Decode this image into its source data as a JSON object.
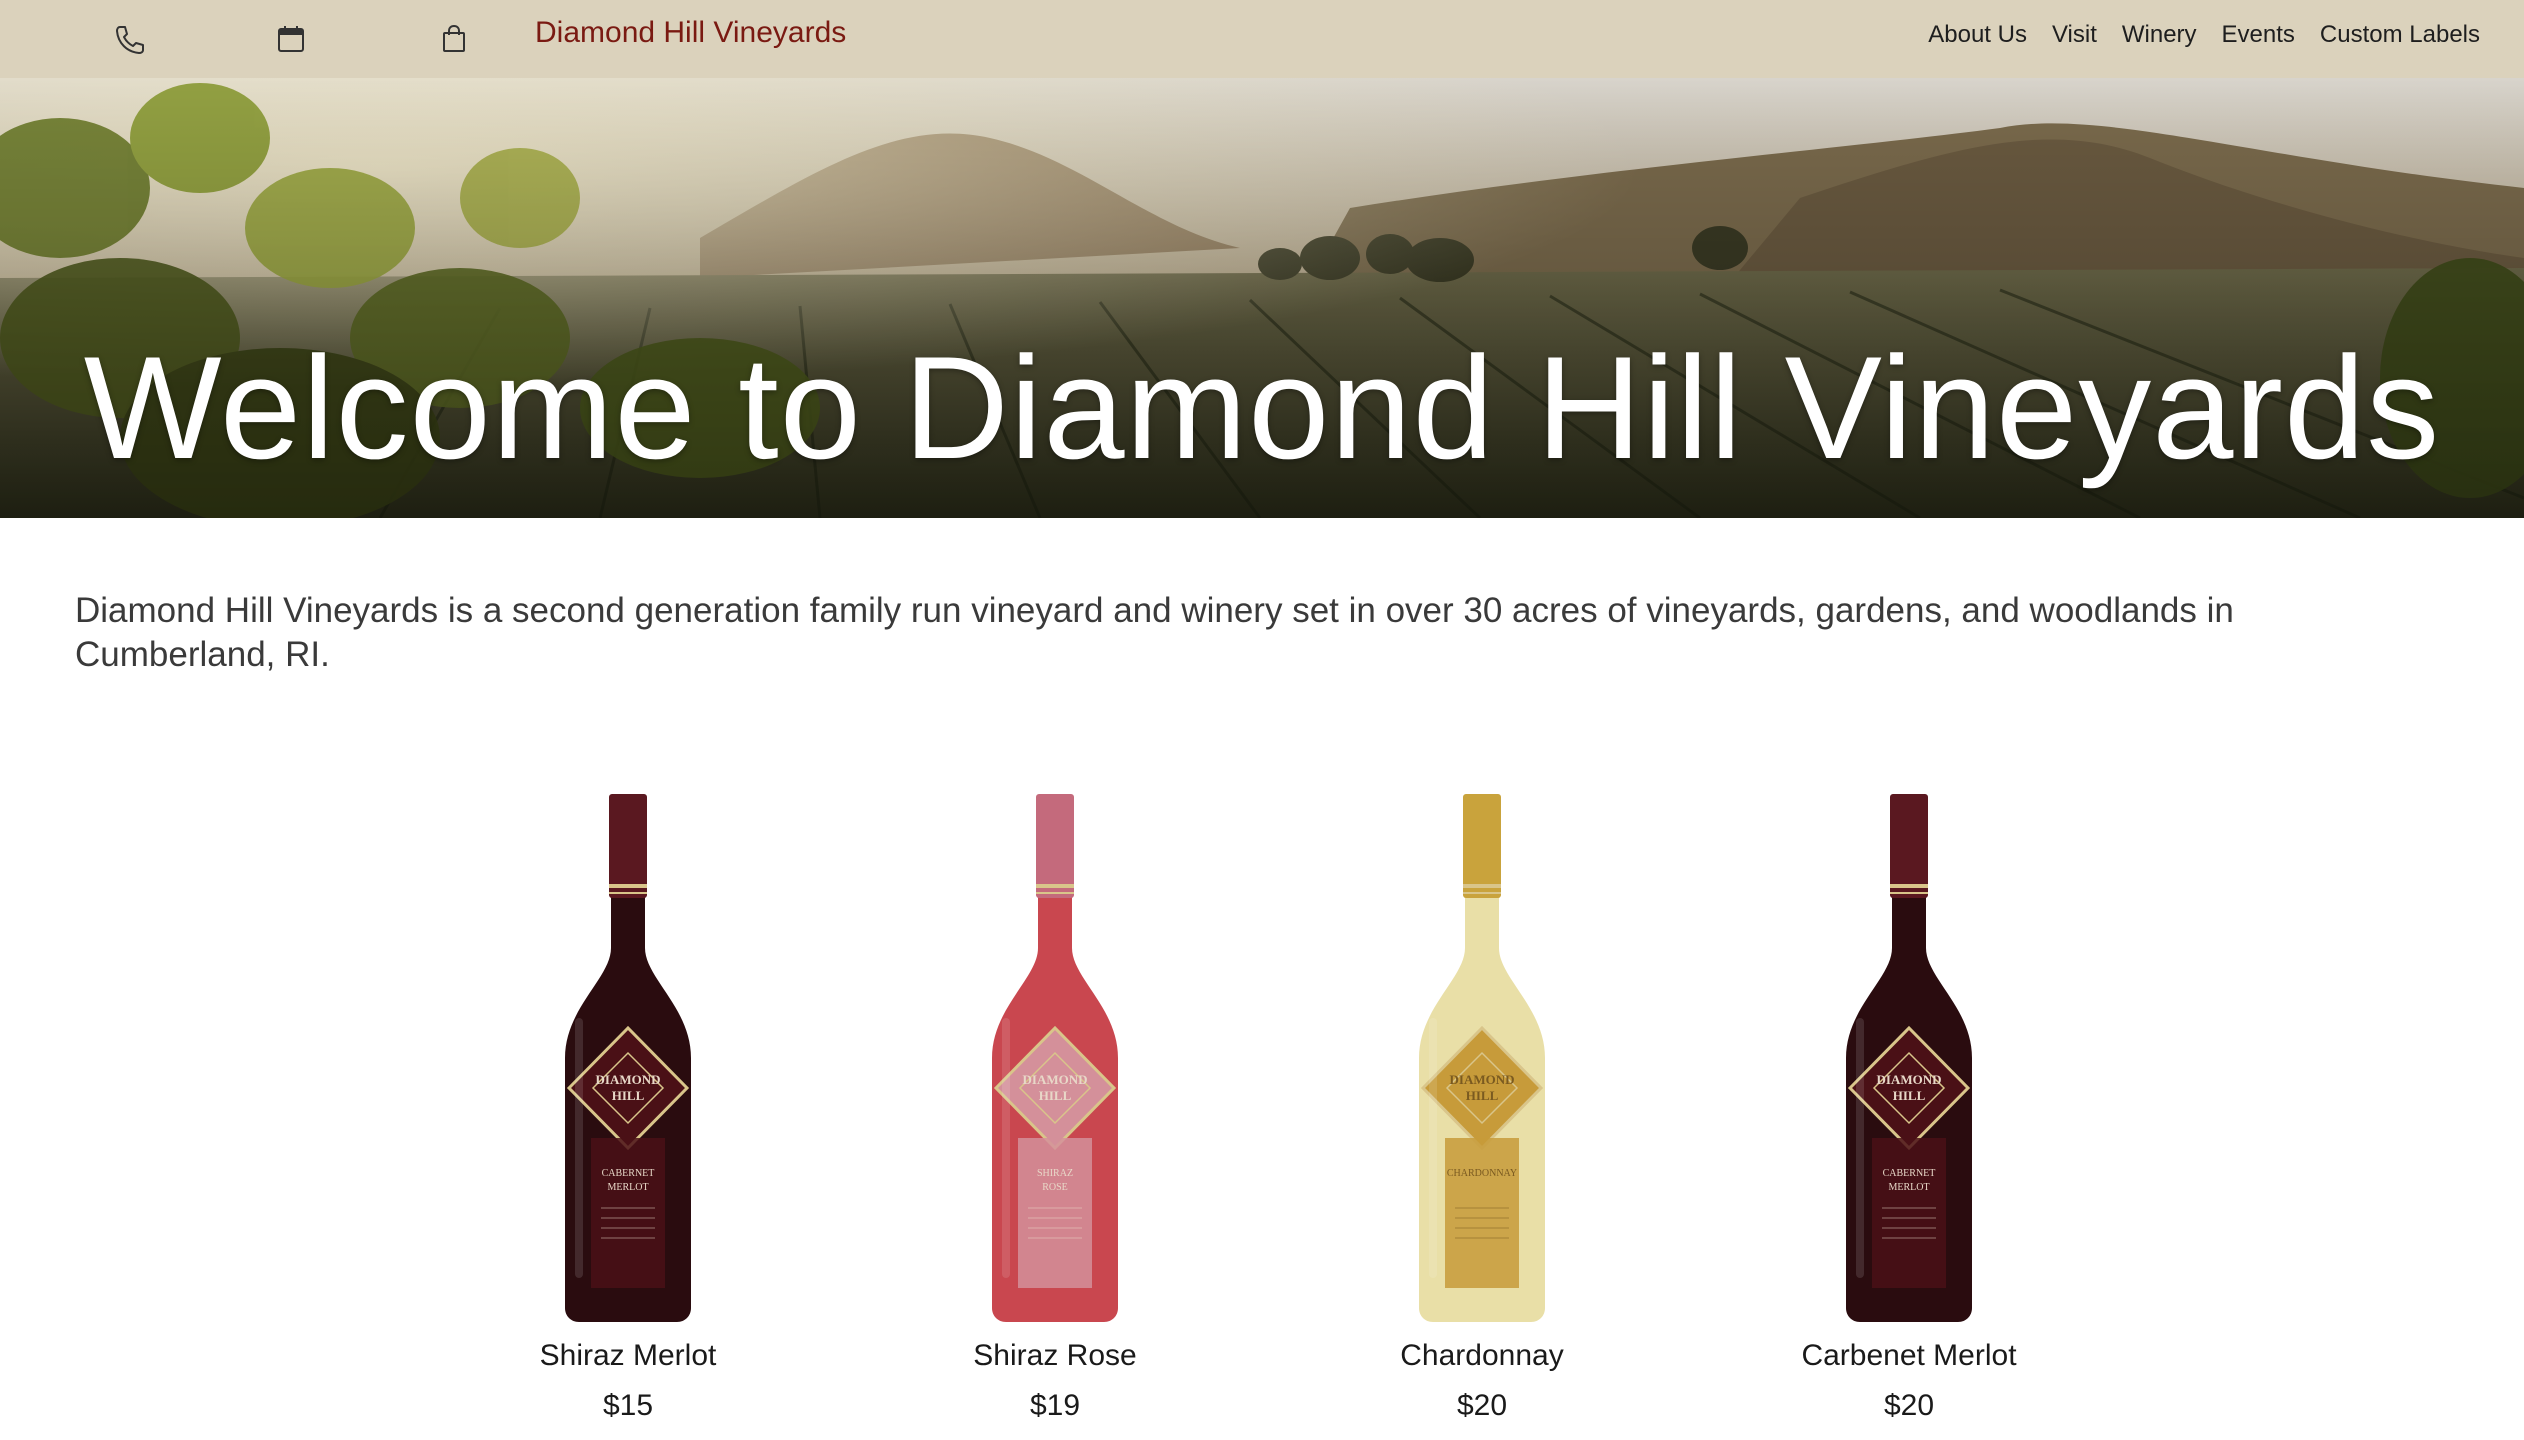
{
  "header": {
    "icons": [
      "phone-icon",
      "calendar-icon",
      "shopping-bag-icon"
    ],
    "brand": "Diamond Hill Vineyards",
    "nav": [
      "About Us",
      "Visit",
      "Winery",
      "Events",
      "Custom Labels"
    ]
  },
  "hero": {
    "title": "Welcome to Diamond Hill Vineyards"
  },
  "intro": {
    "text": "Diamond Hill Vineyards is a second generation family run vineyard and winery set in over 30 acres of vineyards, gardens, and woodlands in Cumberland, RI."
  },
  "products": [
    {
      "name": "Shiraz Merlot",
      "price": "$15",
      "label_text": "CABERNET MERLOT",
      "bottle_color": "#2a0c0f",
      "foil_color": "#5a1820",
      "label_color": "#4a1016"
    },
    {
      "name": "Shiraz Rose",
      "price": "$19",
      "label_text": "SHIRAZ ROSE",
      "bottle_color": "#c9474f",
      "foil_color": "#c46a7c",
      "label_color": "#d4909a"
    },
    {
      "name": "Chardonnay",
      "price": "$20",
      "label_text": "CHARDONNAY",
      "bottle_color": "#e9dfa7",
      "foil_color": "#c9a33c",
      "label_color": "#c79b3a"
    },
    {
      "name": "Carbenet Merlot",
      "price": "$20",
      "label_text": "CABERNET MERLOT",
      "bottle_color": "#2a0c0f",
      "foil_color": "#5a1820",
      "label_color": "#4a1016"
    }
  ],
  "logo_text": "DIAMOND HILL",
  "colors": {
    "topbar_bg": "#dbd2bc",
    "brand_red": "#7a1a12",
    "text_dark": "#1e1e1e",
    "intro_text": "#3a3a3a"
  }
}
